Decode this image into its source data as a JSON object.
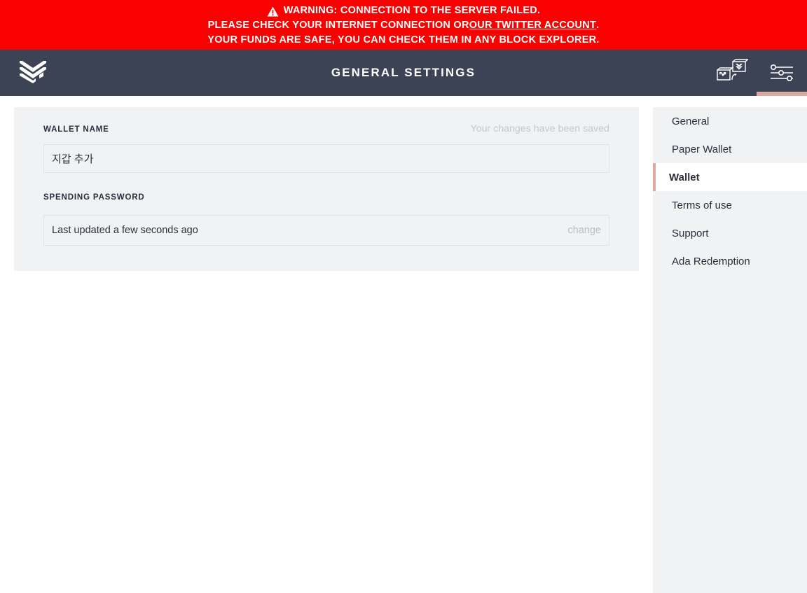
{
  "warning": {
    "icon": "warning-triangle-icon",
    "line1": "WARNING: CONNECTION TO THE SERVER FAILED.",
    "line2_prefix": "PLEASE CHECK YOUR INTERNET CONNECTION OR ",
    "line2_link": "OUR TWITTER ACCOUNT",
    "line2_suffix": ".",
    "line3": "YOUR FUNDS ARE SAFE, YOU CAN CHECK THEM IN ANY BLOCK EXPLORER.",
    "background_color": "#fa0000",
    "text_color": "#ffffff"
  },
  "topbar": {
    "logo_icon": "daedalus-chevron-logo-icon",
    "title": "GENERAL SETTINGS",
    "background_color": "#3b4355",
    "active_indicator_color": "#dba8a2",
    "actions": [
      {
        "icon": "wallet-switch-icon",
        "active": false
      },
      {
        "icon": "settings-sliders-icon",
        "active": true
      }
    ]
  },
  "settings": {
    "wallet_name": {
      "label": "WALLET NAME",
      "value": "지갑 추가",
      "placeholder": "",
      "saved_message": "Your changes have been saved"
    },
    "spending_password": {
      "label": "SPENDING PASSWORD",
      "status": "Last updated a few seconds ago",
      "change_label": "change"
    }
  },
  "sidebar": {
    "items": [
      {
        "label": "General",
        "active": false
      },
      {
        "label": "Paper Wallet",
        "active": false
      },
      {
        "label": "Wallet",
        "active": true
      },
      {
        "label": "Terms of use",
        "active": false
      },
      {
        "label": "Support",
        "active": false
      },
      {
        "label": "Ada Redemption",
        "active": false
      }
    ]
  }
}
